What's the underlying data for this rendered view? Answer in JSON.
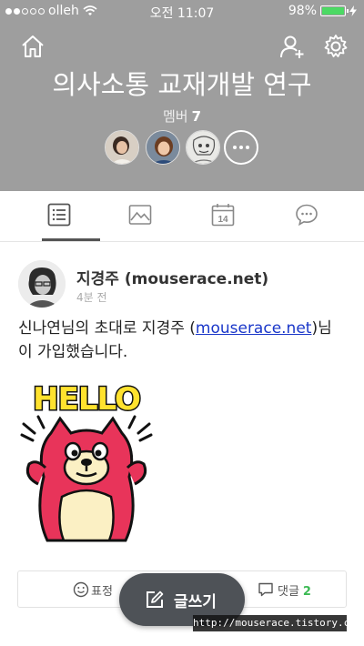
{
  "status_bar": {
    "carrier": "olleh",
    "time": "오전 11:07",
    "battery_percent": "98%",
    "battery_level": 0.98,
    "signal_bars_filled": 2,
    "signal_bars_total": 5
  },
  "header": {
    "background": "#9e9e9e",
    "home_icon": "home-icon",
    "add_member_icon": "add-member-icon",
    "settings_icon": "gear-icon",
    "group_title": "의사소통 교재개발 연구",
    "member_label": "멤버",
    "member_count": "7",
    "more_icon": "more-dots-icon"
  },
  "tabs": [
    {
      "name": "posts",
      "icon": "list-icon",
      "selected": true
    },
    {
      "name": "photos",
      "icon": "photo-icon",
      "selected": false
    },
    {
      "name": "calendar",
      "icon": "calendar-icon",
      "calendar_day": "14",
      "selected": false
    },
    {
      "name": "chat",
      "icon": "chat-bubble-icon",
      "selected": false
    }
  ],
  "post": {
    "author": "지경주 (mouserace.net)",
    "time_ago": "4분 전",
    "body_before": "신나연님의 초대로 지경주 (",
    "body_link": "mouserace.net",
    "body_after": ")님이 가입했습니다.",
    "sticker_text": "HELLO",
    "emotion_label": "표정",
    "comment_label": "댓글",
    "comment_count": "2"
  },
  "write_button": {
    "label": "글쓰기",
    "icon": "edit-icon"
  },
  "watermark": "http://mouserace.tistory.com",
  "colors": {
    "accent_green": "#3cba54",
    "link_blue": "#1a37c9",
    "battery_green": "#4cd964",
    "write_button_bg": "#4e5257"
  }
}
